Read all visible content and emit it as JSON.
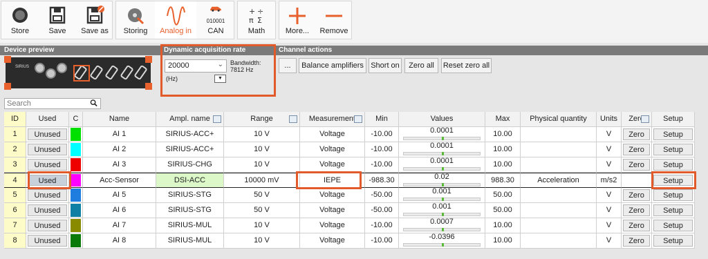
{
  "toolbar": {
    "groups": [
      {
        "buttons": [
          {
            "label": "Store",
            "icon": "record-icon"
          },
          {
            "label": "Save",
            "icon": "floppy-icon"
          },
          {
            "label": "Save as",
            "icon": "floppy-edit-icon"
          }
        ]
      },
      {
        "buttons": [
          {
            "label": "Storing",
            "icon": "storing-icon"
          },
          {
            "label": "Analog in",
            "icon": "sine-wave-icon",
            "active": true
          },
          {
            "label": "CAN",
            "icon": "car-icon",
            "sublabel": "010001"
          }
        ]
      },
      {
        "buttons": [
          {
            "label": "Math",
            "icon": "math-icon"
          }
        ]
      },
      {
        "buttons": [
          {
            "label": "More...",
            "icon": "plus-icon"
          },
          {
            "label": "Remove",
            "icon": "minus-icon"
          }
        ]
      }
    ]
  },
  "sections": {
    "device_preview": "Device preview",
    "dynamic_rate": "Dynamic acquisition rate",
    "channel_actions": "Channel actions"
  },
  "device": {
    "brand": "SIRIUS"
  },
  "acquisition": {
    "rate_value": "20000",
    "unit": "(Hz)",
    "bandwidth_label": "Bandwidth:",
    "bandwidth_value": "7812 Hz"
  },
  "actions": [
    "...",
    "Balance amplifiers",
    "Short on",
    "Zero all",
    "Reset zero all"
  ],
  "search": {
    "placeholder": "Search"
  },
  "table": {
    "headers": {
      "id": "ID",
      "used": "Used",
      "c": "C",
      "name": "Name",
      "ampl": "Ampl. name",
      "range": "Range",
      "measurement": "Measurement",
      "min": "Min",
      "values": "Values",
      "max": "Max",
      "physical": "Physical quantity",
      "units": "Units",
      "zero": "Zero",
      "setup": "Setup"
    },
    "rows": [
      {
        "id": "1",
        "used": "Unused",
        "color": "#00e000",
        "name": "AI 1",
        "ampl": "SIRIUS-ACC+",
        "range": "10 V",
        "measurement": "Voltage",
        "min": "-10.00",
        "value": "0.0001",
        "max": "10.00",
        "physical": "",
        "units": "V",
        "zero": "Zero",
        "setup": "Setup"
      },
      {
        "id": "2",
        "used": "Unused",
        "color": "#00ffff",
        "name": "AI 2",
        "ampl": "SIRIUS-ACC+",
        "range": "10 V",
        "measurement": "Voltage",
        "min": "-10.00",
        "value": "0.0001",
        "max": "10.00",
        "physical": "",
        "units": "V",
        "zero": "Zero",
        "setup": "Setup"
      },
      {
        "id": "3",
        "used": "Unused",
        "color": "#ee0000",
        "name": "AI 3",
        "ampl": "SIRIUS-CHG",
        "range": "10 V",
        "measurement": "Voltage",
        "min": "-10.00",
        "value": "0.0001",
        "max": "10.00",
        "physical": "",
        "units": "V",
        "zero": "Zero",
        "setup": "Setup"
      },
      {
        "id": "4",
        "used": "Used",
        "color": "#ff00ff",
        "name": "Acc-Sensor",
        "ampl": "DSI-ACC",
        "range": "10000 mV",
        "measurement": "IEPE",
        "min": "-988.30",
        "value": "0.02",
        "max": "988.30",
        "physical": "Acceleration",
        "units": "m/s2",
        "zero": "",
        "setup": "Setup"
      },
      {
        "id": "5",
        "used": "Unused",
        "color": "#1e7dde",
        "name": "AI 5",
        "ampl": "SIRIUS-STG",
        "range": "50 V",
        "measurement": "Voltage",
        "min": "-50.00",
        "value": "0.001",
        "max": "50.00",
        "physical": "",
        "units": "V",
        "zero": "Zero",
        "setup": "Setup"
      },
      {
        "id": "6",
        "used": "Unused",
        "color": "#0f7fa3",
        "name": "AI 6",
        "ampl": "SIRIUS-STG",
        "range": "50 V",
        "measurement": "Voltage",
        "min": "-50.00",
        "value": "0.001",
        "max": "50.00",
        "physical": "",
        "units": "V",
        "zero": "Zero",
        "setup": "Setup"
      },
      {
        "id": "7",
        "used": "Unused",
        "color": "#8a8a00",
        "name": "AI 7",
        "ampl": "SIRIUS-MUL",
        "range": "10 V",
        "measurement": "Voltage",
        "min": "-10.00",
        "value": "0.0007",
        "max": "10.00",
        "physical": "",
        "units": "V",
        "zero": "Zero",
        "setup": "Setup"
      },
      {
        "id": "8",
        "used": "Unused",
        "color": "#0a7a0a",
        "name": "AI 8",
        "ampl": "SIRIUS-MUL",
        "range": "10 V",
        "measurement": "Voltage",
        "min": "-10.00",
        "value": "-0.0396",
        "max": "10.00",
        "physical": "",
        "units": "V",
        "zero": "Zero",
        "setup": "Setup"
      }
    ]
  },
  "accent_color": "#e8602c"
}
